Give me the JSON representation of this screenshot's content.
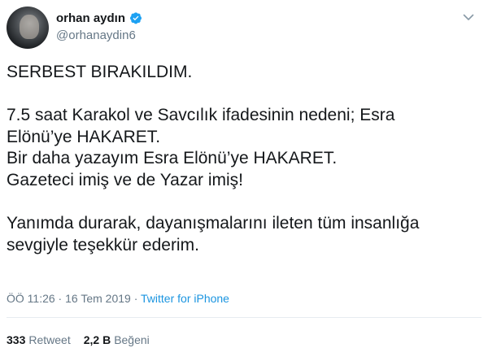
{
  "tweet": {
    "display_name": "orhan aydın",
    "handle": "@orhanaydin6",
    "verified": true,
    "text": "SERBEST BIRAKILDIM.\n\n7.5 saat Karakol ve Savcılık  ifadesinin nedeni; Esra\nElönü’ye HAKARET.\nBir daha yazayım Esra Elönü’ye HAKARET.\nGazeteci imiş ve de Yazar imiş!\n\nYanımda durarak, dayanışmalarını ileten  tüm insanlığa\nsevgiyle teşekkür ederim.",
    "time": "ÖÖ 11:26",
    "date": "16 Tem 2019",
    "separator": " · ",
    "source": "Twitter for iPhone",
    "retweets_count": "333",
    "retweets_label": "Retweet",
    "likes_count": "2,2 B",
    "likes_label": "Beğeni"
  },
  "icons": {
    "verified": "verified-badge-icon",
    "menu": "chevron-down-icon"
  },
  "colors": {
    "text": "#14171a",
    "secondary": "#657786",
    "accent": "#1b95e0",
    "verified": "#1da1f2",
    "divider": "#e6ecf0"
  }
}
